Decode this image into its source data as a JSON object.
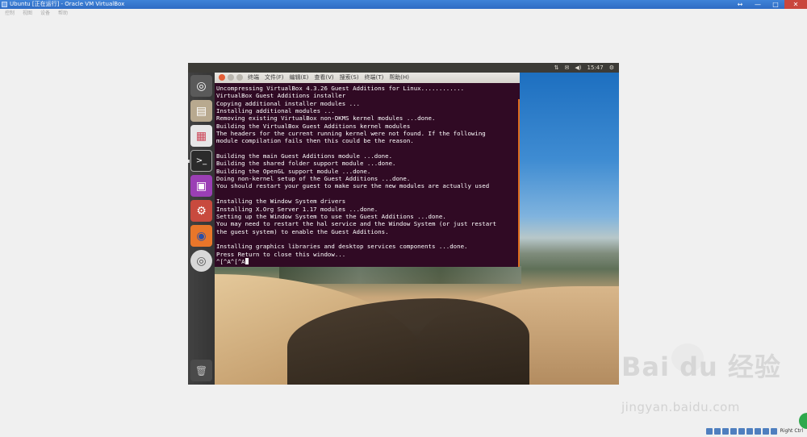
{
  "host": {
    "title": "Ubuntu [正在运行] - Oracle VM VirtualBox",
    "controls": [
      "↔",
      "—",
      "□",
      "✕"
    ],
    "menu": [
      "控制",
      "视图",
      "设备",
      "帮助"
    ],
    "status": {
      "host_key": "Right Ctrl"
    }
  },
  "guest": {
    "panel": {
      "tray": [
        "⇅",
        "✉",
        "◀)",
        "15:47",
        "⚙"
      ]
    },
    "launcher": {
      "items": [
        {
          "name": "dash",
          "glyph": "◎"
        },
        {
          "name": "files",
          "glyph": "▤"
        },
        {
          "name": "document",
          "glyph": "▦"
        },
        {
          "name": "terminal",
          "glyph": ">_"
        },
        {
          "name": "gallery",
          "glyph": "▣"
        },
        {
          "name": "settings",
          "glyph": "⚙"
        },
        {
          "name": "firefox",
          "glyph": "◉"
        },
        {
          "name": "dvd",
          "glyph": "◎"
        },
        {
          "name": "trash",
          "glyph": "🗑"
        }
      ]
    },
    "terminal": {
      "menu": [
        "终端",
        "文件(F)",
        "编辑(E)",
        "查看(V)",
        "搜索(S)",
        "终端(T)",
        "帮助(H)"
      ],
      "lines": [
        "Uncompressing VirtualBox 4.3.26 Guest Additions for Linux............",
        "VirtualBox Guest Additions installer",
        "Copying additional installer modules ...",
        "Installing additional modules ...",
        "Removing existing VirtualBox non-DKMS kernel modules ...done.",
        "Building the VirtualBox Guest Additions kernel modules",
        "The headers for the current running kernel were not found. If the following",
        "module compilation fails then this could be the reason.",
        "",
        "Building the main Guest Additions module ...done.",
        "Building the shared folder support module ...done.",
        "Building the OpenGL support module ...done.",
        "Doing non-kernel setup of the Guest Additions ...done.",
        "You should restart your guest to make sure the new modules are actually used",
        "",
        "Installing the Window System drivers",
        "Installing X.Org Server 1.17 modules ...done.",
        "Setting up the Window System to use the Guest Additions ...done.",
        "You may need to restart the hal service and the Window System (or just restart",
        "the guest system) to enable the Guest Additions.",
        "",
        "Installing graphics libraries and desktop services components ...done.",
        "Press Return to close this window..."
      ],
      "prompt": "^[^A^[^A"
    }
  },
  "watermark": {
    "logo": "Bai du 经验",
    "url": "jingyan.baidu.com"
  }
}
